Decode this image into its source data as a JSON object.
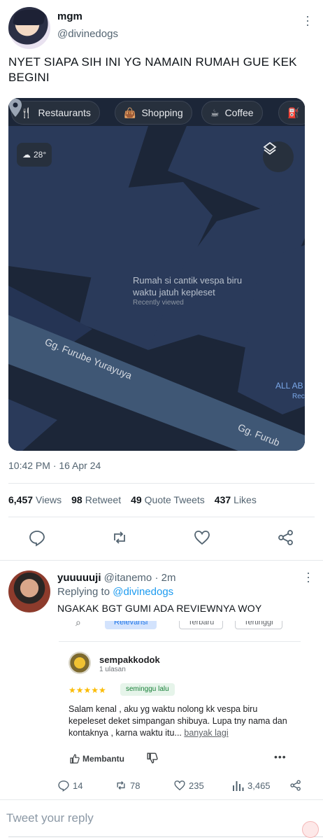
{
  "tweet": {
    "display_name": "mgm",
    "handle": "@divinedogs",
    "text": "NYET SIAPA SIH INI YG NAMAIN RUMAH GUE KEK BEGINI",
    "timestamp": "10:42 PM · 16 Apr 24",
    "stats": {
      "views_count": "6,457",
      "views_label": "Views",
      "retweet_count": "98",
      "retweet_label": "Retweet",
      "quote_count": "49",
      "quote_label": "Quote Tweets",
      "likes_count": "437",
      "likes_label": "Likes"
    }
  },
  "map": {
    "chips": [
      "Restaurants",
      "Shopping",
      "Coffee",
      "G"
    ],
    "temperature": "28°",
    "place_label": "Rumah si cantik vespa biru waktu jatuh kepleset",
    "place_sub": "Recently viewed",
    "street_1": "Gg. Furube Yurayuya",
    "street_2": "Gg. Furub",
    "poi_1": "ALL AB",
    "poi_2": "Rec"
  },
  "reply": {
    "display_name": "yuuuuuji",
    "handle": "@itanemo",
    "time": "· 2m",
    "replying_prefix": "Replying to",
    "replying_to": "@divinedogs",
    "text": "NGAKAK BGT GUMI ADA REVIEWNYA WOY",
    "review": {
      "filters": [
        "Relevansi",
        "Terbaru",
        "Tertinggi"
      ],
      "reviewer": "sempakkodok",
      "review_count": "1 ulasan",
      "stars": "★★★★★",
      "when": "seminggu lalu",
      "body": "Salam kenal , aku yg waktu nolong kk vespa biru kepeleset deket simpangan shibuya. Lupa tny nama dan kontaknya , karna waktu itu...",
      "more": "banyak lagi",
      "helpful": "Membantu",
      "more_dots": "•••"
    },
    "actions": {
      "replies": "14",
      "retweets": "78",
      "likes": "235",
      "views": "3,465"
    }
  },
  "compose": {
    "placeholder": "Tweet your reply"
  },
  "colors": {
    "link": "#1d9bf0",
    "map_bg": "#1e2a40",
    "muted": "#536471"
  }
}
